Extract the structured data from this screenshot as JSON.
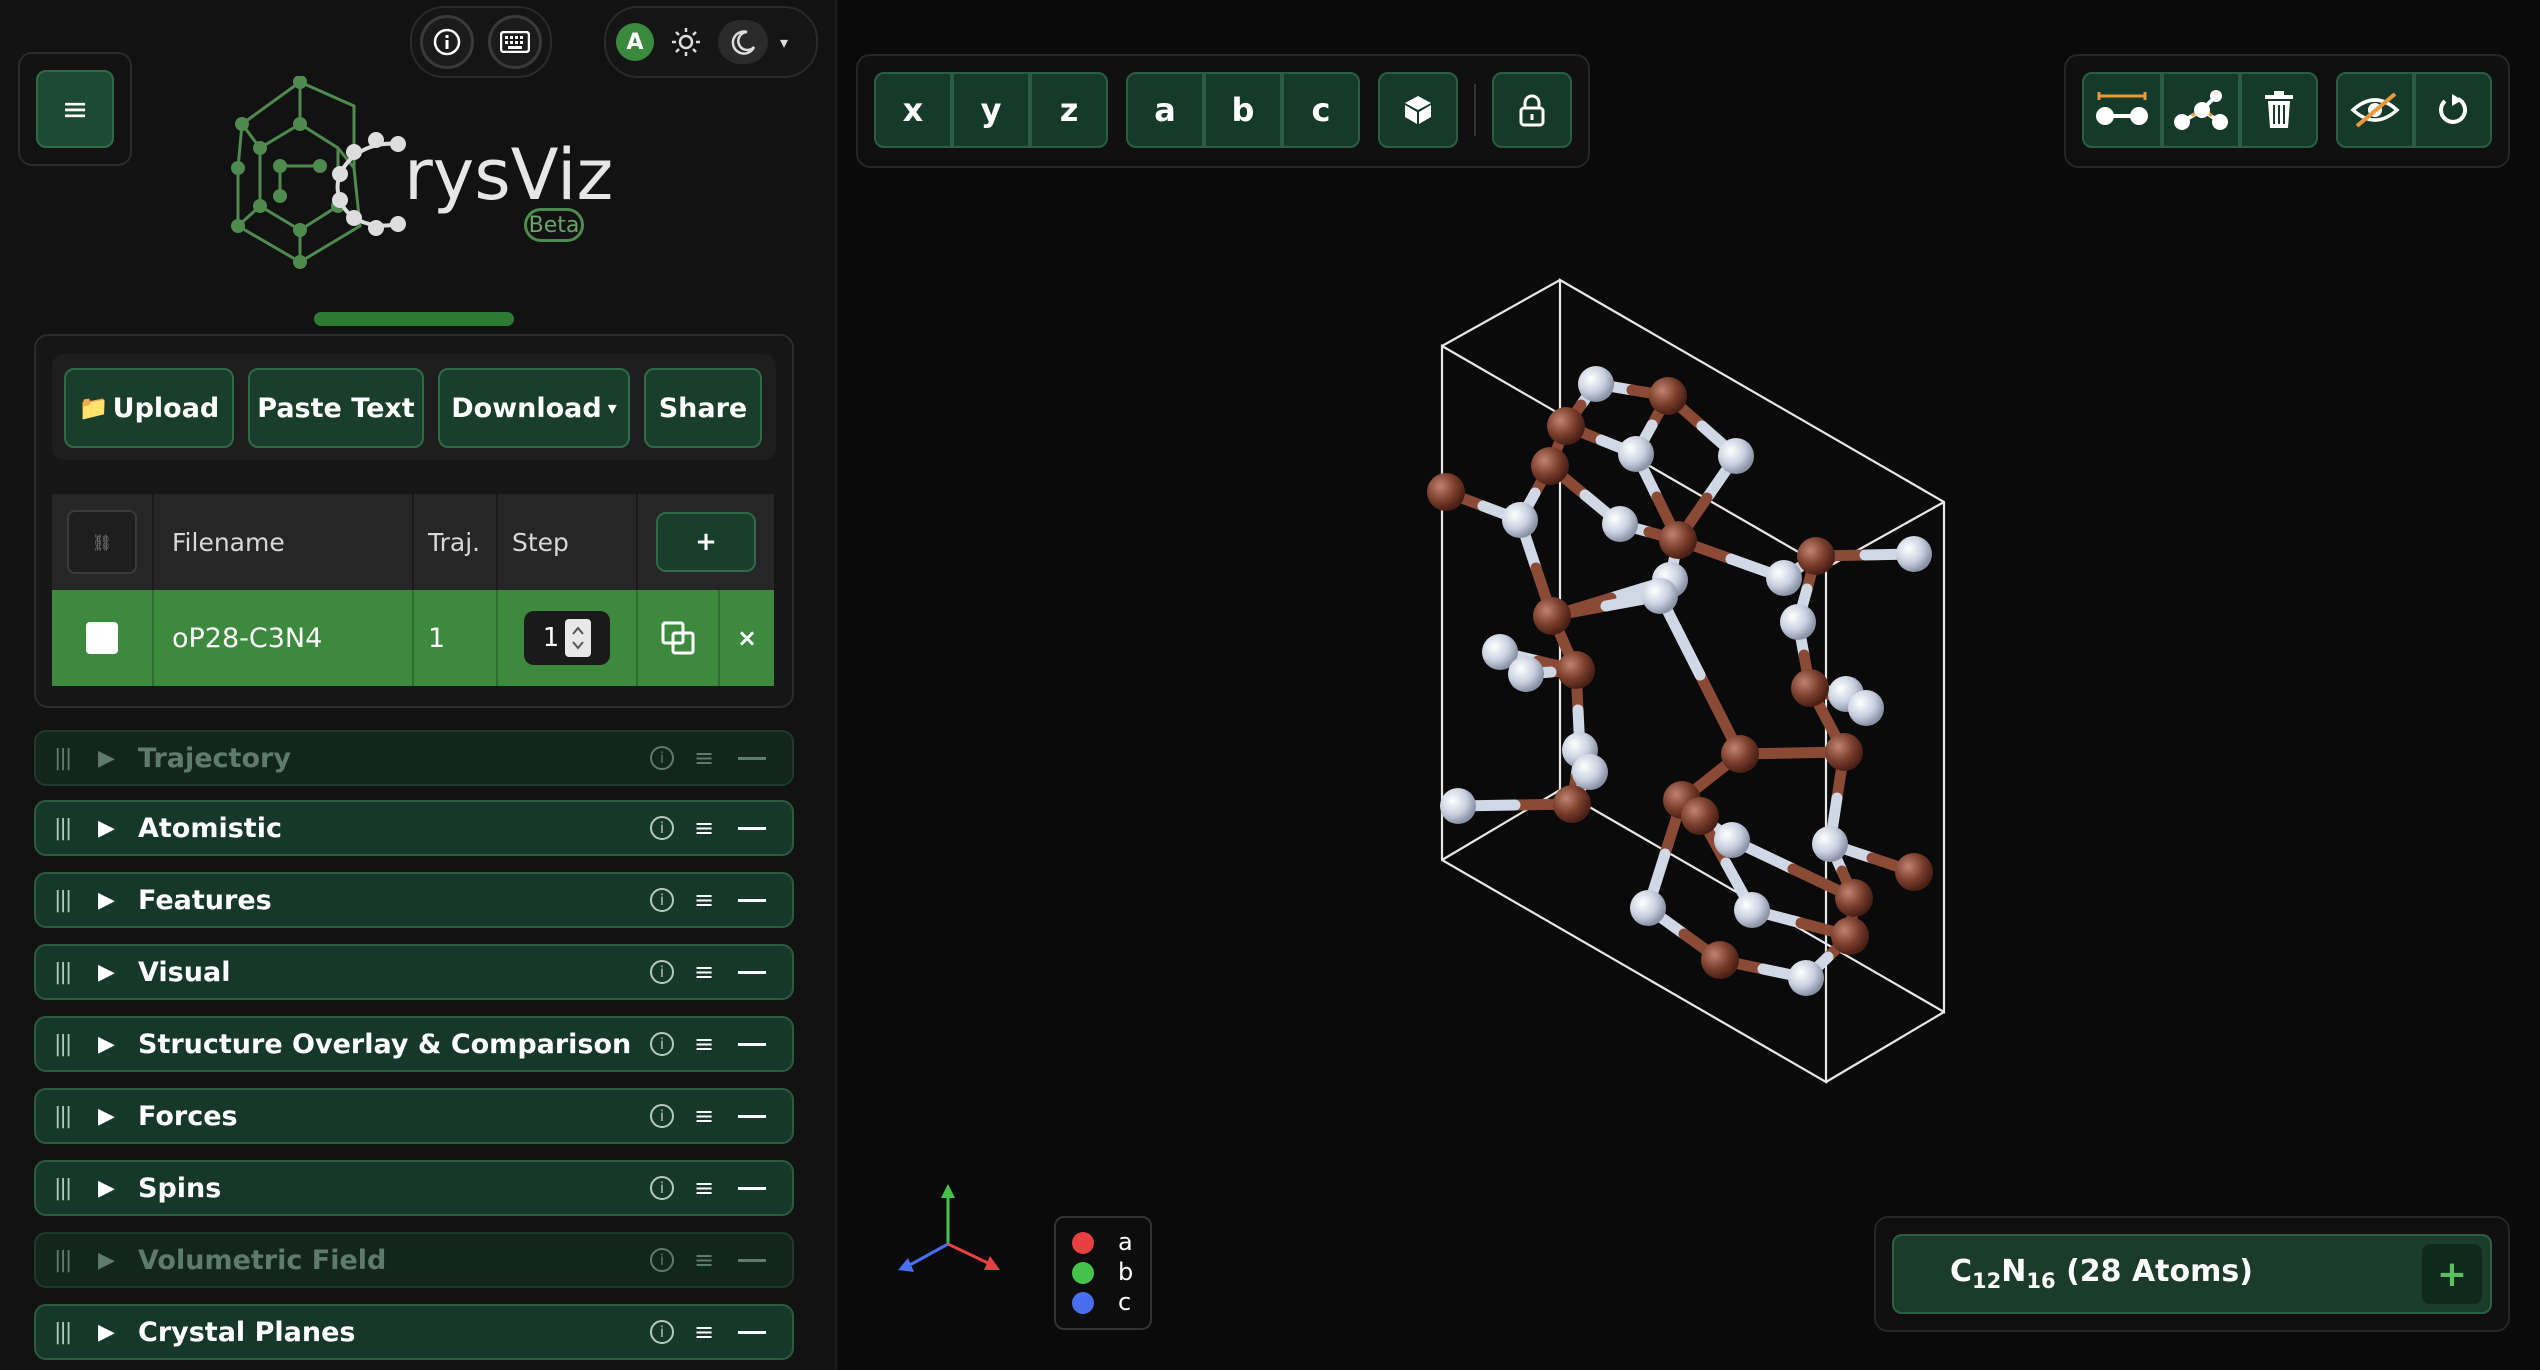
{
  "app": {
    "brand_letter": "C",
    "brand_rest": "rysViz",
    "badge": "Beta"
  },
  "header": {
    "info_icon": "info-icon",
    "keyboard_icon": "keyboard-icon",
    "avatar_letter": "A",
    "menu_glyph": "≡",
    "caret_glyph": "▾"
  },
  "toolbar": {
    "upload_icon": "📁",
    "upload": "Upload",
    "paste": "Paste Text",
    "download": "Download",
    "download_caret": "▾",
    "share": "Share"
  },
  "file_table": {
    "link_glyph": "⛓",
    "columns": [
      "Filename",
      "Traj.",
      "Step"
    ],
    "add_glyph": "+",
    "rows": [
      {
        "filename": "oP28-C3N4",
        "traj": "1",
        "step": "1",
        "remove_glyph": "×"
      }
    ]
  },
  "sections": [
    {
      "label": "Trajectory",
      "enabled": false
    },
    {
      "label": "Atomistic",
      "enabled": true
    },
    {
      "label": "Features",
      "enabled": true
    },
    {
      "label": "Visual",
      "enabled": true
    },
    {
      "label": "Structure Overlay & Comparison",
      "enabled": true
    },
    {
      "label": "Forces",
      "enabled": true
    },
    {
      "label": "Spins",
      "enabled": true
    },
    {
      "label": "Volumetric Field",
      "enabled": false
    },
    {
      "label": "Crystal Planes",
      "enabled": true
    }
  ],
  "section_glyphs": {
    "grip": "|||",
    "triangle": "▶",
    "info": "i",
    "menu": "≡"
  },
  "view_axes": [
    "x",
    "y",
    "z"
  ],
  "lattice_axes": [
    "a",
    "b",
    "c"
  ],
  "axis_legend": [
    "a",
    "b",
    "c"
  ],
  "formula": {
    "c": "C",
    "c_sub": "12",
    "n": "N",
    "n_sub": "16",
    "atoms": "(28 Atoms)",
    "plus": "+"
  },
  "colors": {
    "accent_green": "#1d4a33",
    "row_green": "#3d8a3f",
    "carbon": "#8a4a36",
    "nitrogen": "#d0d8e6",
    "axis_a": "#e84040",
    "axis_b": "#45c24a",
    "axis_c": "#4a6ef0"
  }
}
